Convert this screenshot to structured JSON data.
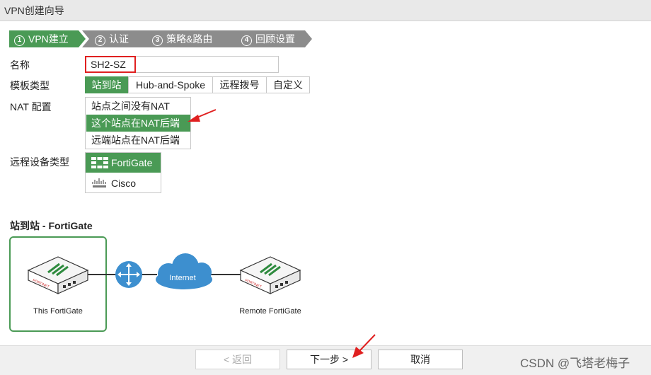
{
  "window": {
    "title": "VPN创建向导"
  },
  "steps": [
    {
      "num": "1",
      "label": "VPN建立",
      "active": true
    },
    {
      "num": "2",
      "label": "认证",
      "active": false
    },
    {
      "num": "3",
      "label": "策略&路由",
      "active": false
    },
    {
      "num": "4",
      "label": "回顾设置",
      "active": false
    }
  ],
  "form": {
    "name_label": "名称",
    "name_value": "SH2-SZ",
    "template_label": "模板类型",
    "template_options": [
      "站到站",
      "Hub-and-Spoke",
      "远程拨号",
      "自定义"
    ],
    "template_selected": "站到站",
    "nat_label": "NAT 配置",
    "nat_options": [
      "站点之间没有NAT",
      "这个站点在NAT后端",
      "远端站点在NAT后端"
    ],
    "nat_selected": "这个站点在NAT后端",
    "device_label": "远程设备类型",
    "device_options": [
      "FortiGate",
      "Cisco"
    ],
    "device_selected": "FortiGate"
  },
  "diagram": {
    "title": "站到站 - FortiGate",
    "local_label": "This FortiGate",
    "remote_label": "Remote FortiGate",
    "cloud_label": "Internet",
    "device_brand": "FORTINET"
  },
  "footer": {
    "back_label": "< 返回",
    "next_label": "下一步 >",
    "cancel_label": "取消"
  },
  "watermark": "CSDN @飞塔老梅子",
  "colors": {
    "accent": "#4a9a55",
    "step_inactive": "#8c8c8c",
    "highlight_red": "#e02020",
    "cloud_blue": "#3d8fcf"
  }
}
